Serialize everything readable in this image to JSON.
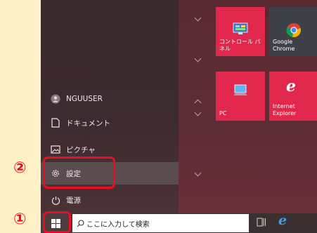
{
  "steps": {
    "step1": "①",
    "step2": "②"
  },
  "user": {
    "name": "NGUUSER"
  },
  "menu": {
    "documents": "ドキュメント",
    "pictures": "ピクチャ",
    "settings": "設定",
    "power": "電源"
  },
  "tiles": {
    "control_panel": "コントロール パネル",
    "chrome": "Google Chrome",
    "pc": "PC",
    "ie": "Internet Explorer"
  },
  "taskbar": {
    "search_placeholder": "ここに入力して検索"
  },
  "colors": {
    "highlight": "#e81020",
    "tile_red": "#e2274c",
    "tile_gray": "#3e4248",
    "background": "#fff0c8"
  }
}
